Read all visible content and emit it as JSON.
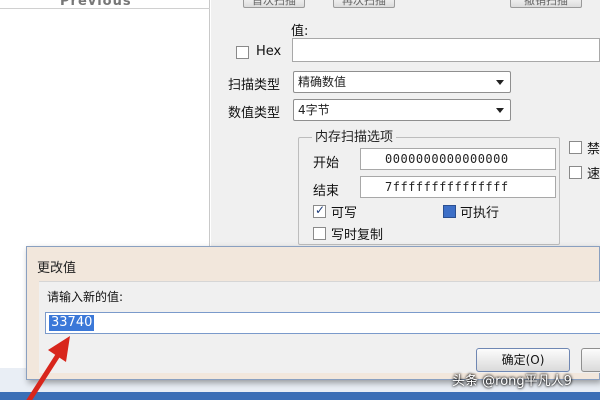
{
  "scan_window": {
    "results_header": "Previous",
    "top_buttons": [
      "首次扫描",
      "再次扫描",
      "撤销扫描"
    ],
    "value_label": "值:",
    "hex_label": "Hex",
    "hex_checked": false,
    "scan_type_label": "扫描类型",
    "scan_type_value": "精确数值",
    "value_type_label": "数值类型",
    "value_type_value": "4字节",
    "memory_options": {
      "title": "内存扫描选项",
      "start_label": "开始",
      "start_value": "0000000000000000",
      "end_label": "结束",
      "end_value": "7fffffffffffffff",
      "writable_label": "可写",
      "writable_checked": true,
      "executable_label": "可执行",
      "executable_checked": true,
      "copy_on_write_label": "写时复制",
      "copy_on_write_checked": false
    },
    "side_options": [
      "禁",
      "速"
    ]
  },
  "dialog": {
    "title": "更改值",
    "prompt": "请输入新的值:",
    "value": "33740",
    "ok_label": "确定(O)",
    "cancel_label": ""
  },
  "watermark": "头条 @rong平凡人9",
  "colors": {
    "dialog_bg": "#f2e7dc",
    "selection": "#3b78d8",
    "arrow": "#d8261c"
  }
}
